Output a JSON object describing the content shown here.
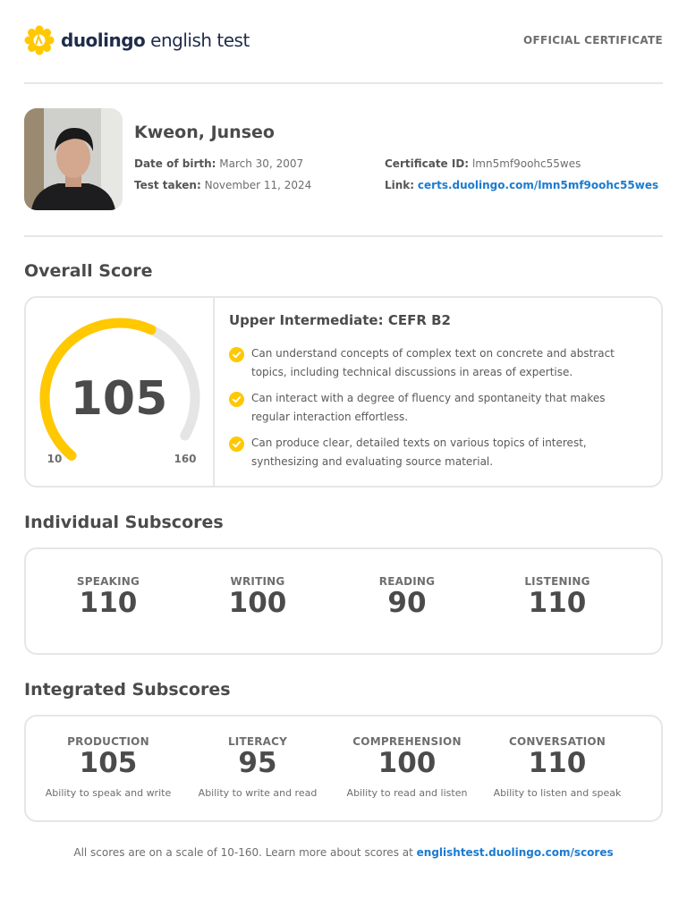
{
  "brand": {
    "name": "duolingo",
    "product": "english test",
    "accent": "#ffc800",
    "logo_icon": "duolingo-sun-icon"
  },
  "header": {
    "badge": "OFFICIAL CERTIFICATE"
  },
  "candidate": {
    "name": "Kweon, Junseo",
    "dob_label": "Date of birth:",
    "dob": "March 30, 2007",
    "test_taken_label": "Test taken:",
    "test_taken": "November 11, 2024",
    "cert_id_label": "Certificate ID:",
    "cert_id": "lmn5mf9oohc55wes",
    "link_label": "Link:",
    "link": "certs.duolingo.com/lmn5mf9oohc55wes"
  },
  "overall": {
    "title": "Overall Score",
    "score": "105",
    "scale_min": "10",
    "scale_max": "160",
    "level": "Upper Intermediate: CEFR B2",
    "can_do": [
      "Can understand concepts of complex text on concrete and abstract topics, including technical discussions in areas of expertise.",
      "Can interact with a degree of fluency and spontaneity that makes regular interaction effortless.",
      "Can produce clear, detailed texts on various topics of interest, synthesizing and evaluating source material."
    ]
  },
  "individual": {
    "title": "Individual Subscores",
    "items": [
      {
        "label": "SPEAKING",
        "value": "110"
      },
      {
        "label": "WRITING",
        "value": "100"
      },
      {
        "label": "READING",
        "value": "90"
      },
      {
        "label": "LISTENING",
        "value": "110"
      }
    ]
  },
  "integrated": {
    "title": "Integrated Subscores",
    "items": [
      {
        "label": "PRODUCTION",
        "value": "105",
        "desc": "Ability to speak and write"
      },
      {
        "label": "LITERACY",
        "value": "95",
        "desc": "Ability to write and read"
      },
      {
        "label": "COMPREHENSION",
        "value": "100",
        "desc": "Ability to read and listen"
      },
      {
        "label": "CONVERSATION",
        "value": "110",
        "desc": "Ability to listen and speak"
      }
    ]
  },
  "footer": {
    "text": "All scores are on a scale of 10-160. Learn more about scores at ",
    "link": "englishtest.duolingo.com/scores"
  }
}
